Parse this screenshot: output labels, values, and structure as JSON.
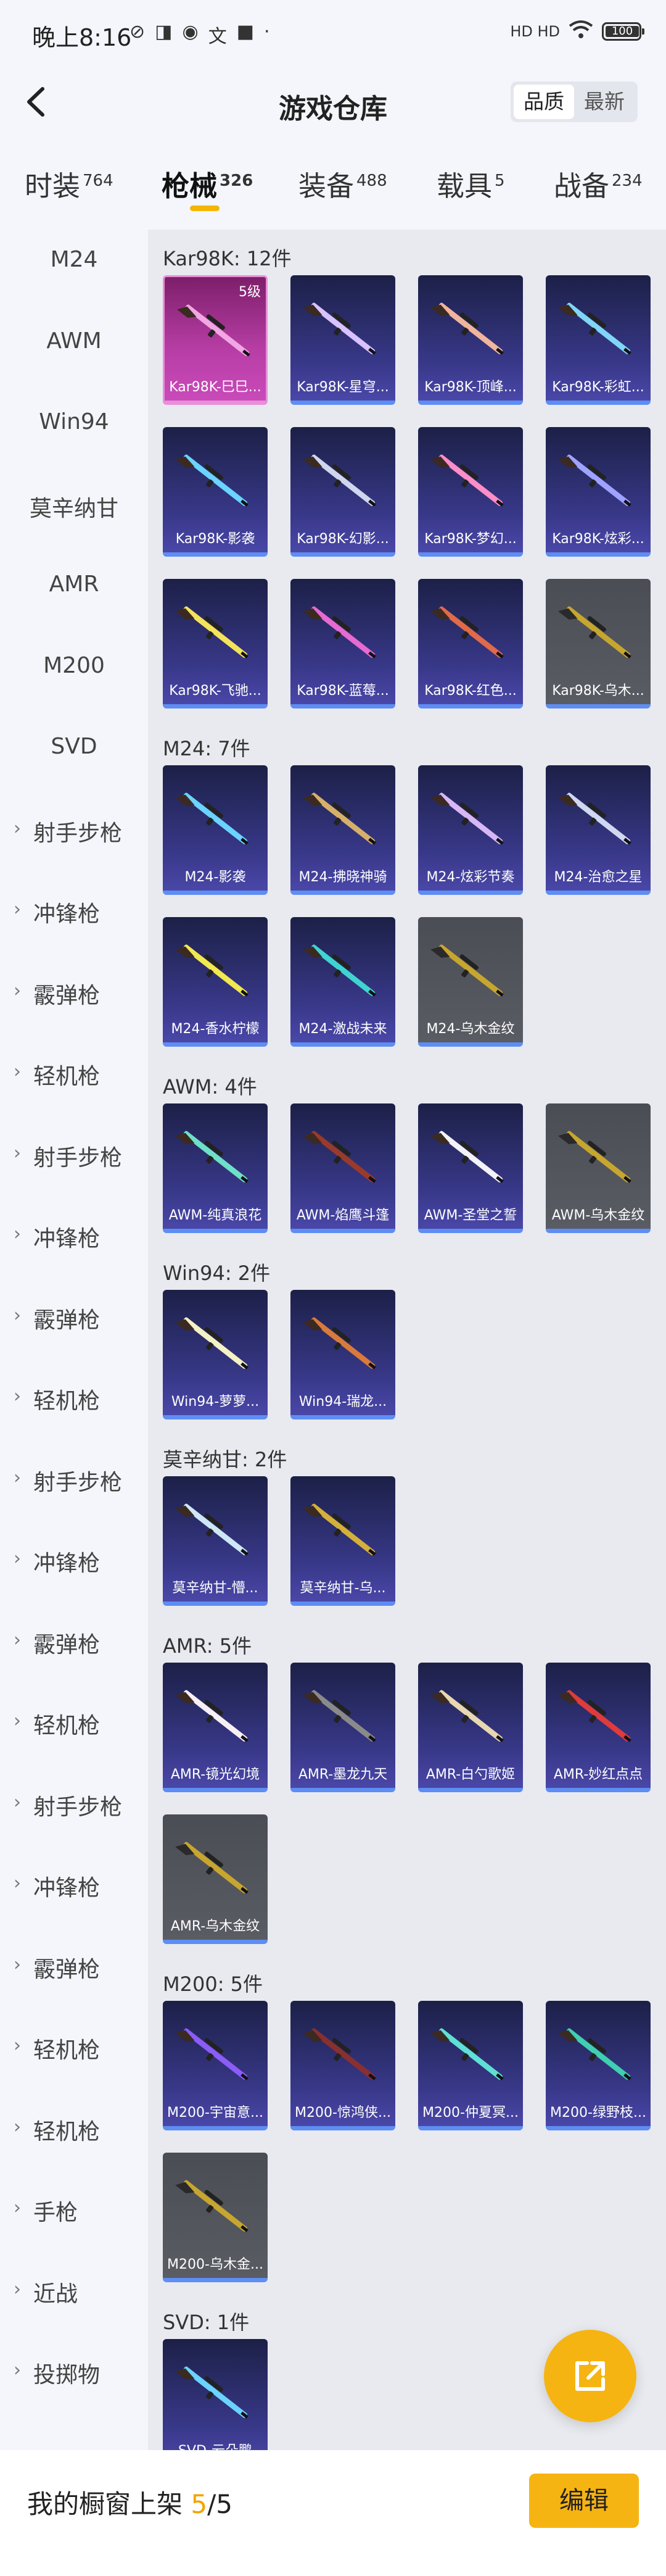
{
  "status": {
    "time": "晚上8:16",
    "network": "HD HD",
    "battery": "100"
  },
  "header": {
    "title": "游戏仓库",
    "sort_options": [
      "品质",
      "最新"
    ],
    "sort_active": 0
  },
  "tabs": [
    {
      "label": "时装",
      "count": "764"
    },
    {
      "label": "枪械",
      "count": "326"
    },
    {
      "label": "装备",
      "count": "488"
    },
    {
      "label": "载具",
      "count": "5"
    },
    {
      "label": "战备",
      "count": "234"
    }
  ],
  "active_tab": 1,
  "sidebar": {
    "items": [
      {
        "label": "M24",
        "chevron": false
      },
      {
        "label": "AWM",
        "chevron": false
      },
      {
        "label": "Win94",
        "chevron": false
      },
      {
        "label": "莫辛纳甘",
        "chevron": false
      },
      {
        "label": "AMR",
        "chevron": false
      },
      {
        "label": "M200",
        "chevron": false
      },
      {
        "label": "SVD",
        "chevron": false
      },
      {
        "label": "射手步枪",
        "chevron": true
      },
      {
        "label": "冲锋枪",
        "chevron": true
      },
      {
        "label": "霰弹枪",
        "chevron": true
      },
      {
        "label": "轻机枪",
        "chevron": true
      },
      {
        "label": "射手步枪",
        "chevron": true
      },
      {
        "label": "冲锋枪",
        "chevron": true
      },
      {
        "label": "霰弹枪",
        "chevron": true
      },
      {
        "label": "轻机枪",
        "chevron": true
      },
      {
        "label": "射手步枪",
        "chevron": true
      },
      {
        "label": "冲锋枪",
        "chevron": true
      },
      {
        "label": "霰弹枪",
        "chevron": true
      },
      {
        "label": "轻机枪",
        "chevron": true
      },
      {
        "label": "射手步枪",
        "chevron": true
      },
      {
        "label": "冲锋枪",
        "chevron": true
      },
      {
        "label": "霰弹枪",
        "chevron": true
      },
      {
        "label": "轻机枪",
        "chevron": true
      },
      {
        "label": "轻机枪",
        "chevron": true
      },
      {
        "label": "手枪",
        "chevron": true
      },
      {
        "label": "近战",
        "chevron": true
      },
      {
        "label": "投掷物",
        "chevron": true
      }
    ]
  },
  "sections": [
    {
      "title": "Kar98K: 12件",
      "items": [
        {
          "name": "Kar98K-巳巳...",
          "style": "pink",
          "level": "5级",
          "color": "#f2a6e4"
        },
        {
          "name": "Kar98K-星穹...",
          "style": "blue",
          "color": "#d8c2ff"
        },
        {
          "name": "Kar98K-顶峰...",
          "style": "blue",
          "color": "#f0b59c"
        },
        {
          "name": "Kar98K-彩虹...",
          "style": "blue",
          "color": "#7fd6f7"
        },
        {
          "name": "Kar98K-影袭",
          "style": "blue",
          "color": "#6ad3ff"
        },
        {
          "name": "Kar98K-幻影...",
          "style": "blue",
          "color": "#d0d6ee"
        },
        {
          "name": "Kar98K-梦幻...",
          "style": "blue",
          "color": "#ff8dc8"
        },
        {
          "name": "Kar98K-炫彩...",
          "style": "blue",
          "color": "#9fa3ff"
        },
        {
          "name": "Kar98K-飞驰...",
          "style": "blue",
          "color": "#f4e35a"
        },
        {
          "name": "Kar98K-蓝莓...",
          "style": "blue",
          "color": "#e66ad1"
        },
        {
          "name": "Kar98K-红色...",
          "style": "blue",
          "color": "#e06a4a"
        },
        {
          "name": "Kar98K-乌木...",
          "style": "gray",
          "color": "#c7a62f"
        }
      ]
    },
    {
      "title": "M24: 7件",
      "items": [
        {
          "name": "M24-影袭",
          "style": "blue",
          "color": "#6ad3ff"
        },
        {
          "name": "M24-拂晓神骑",
          "style": "blue",
          "color": "#d6b06a"
        },
        {
          "name": "M24-炫彩节奏",
          "style": "blue",
          "color": "#d7b7f5"
        },
        {
          "name": "M24-治愈之星",
          "style": "blue",
          "color": "#cfd8f0"
        },
        {
          "name": "M24-香水柠檬",
          "style": "blue",
          "color": "#f1e94f"
        },
        {
          "name": "M24-激战未来",
          "style": "blue",
          "color": "#3fd4d1"
        },
        {
          "name": "M24-乌木金纹",
          "style": "gray",
          "color": "#c7a62f"
        }
      ]
    },
    {
      "title": "AWM: 4件",
      "items": [
        {
          "name": "AWM-纯真浪花",
          "style": "blue",
          "color": "#6fe0c8"
        },
        {
          "name": "AWM-焰鹰斗篷",
          "style": "blue",
          "color": "#9a3a2a"
        },
        {
          "name": "AWM-圣堂之誓",
          "style": "blue",
          "color": "#f3f3f7"
        },
        {
          "name": "AWM-乌木金纹",
          "style": "gray",
          "color": "#c7a62f"
        }
      ]
    },
    {
      "title": "Win94: 2件",
      "items": [
        {
          "name": "Win94-萝萝...",
          "style": "blue",
          "color": "#f4f1c4"
        },
        {
          "name": "Win94-瑞龙...",
          "style": "blue",
          "color": "#d97a3b"
        }
      ]
    },
    {
      "title": "莫辛纳甘: 2件",
      "items": [
        {
          "name": "莫辛纳甘-懵...",
          "style": "blue",
          "color": "#cfe6f7"
        },
        {
          "name": "莫辛纳甘-乌...",
          "style": "blue",
          "color": "#d4b03a"
        }
      ]
    },
    {
      "title": "AMR: 5件",
      "items": [
        {
          "name": "AMR-镜光幻境",
          "style": "blue",
          "color": "#f6f0f4"
        },
        {
          "name": "AMR-墨龙九天",
          "style": "blue",
          "color": "#8a8a8a"
        },
        {
          "name": "AMR-白勺歌姬",
          "style": "blue",
          "color": "#e8d7b2"
        },
        {
          "name": "AMR-妙红点点",
          "style": "blue",
          "color": "#e03b3b"
        },
        {
          "name": "AMR-乌木金纹",
          "style": "gray",
          "color": "#c7a62f"
        }
      ]
    },
    {
      "title": "M200: 5件",
      "items": [
        {
          "name": "M200-宇宙意...",
          "style": "blue",
          "color": "#8b5cf6"
        },
        {
          "name": "M200-惊鸿侠...",
          "style": "blue",
          "color": "#8a2f2f"
        },
        {
          "name": "M200-仲夏冥...",
          "style": "blue",
          "color": "#5fe0d4"
        },
        {
          "name": "M200-绿野枝...",
          "style": "blue",
          "color": "#3fcfb0"
        },
        {
          "name": "M200-乌木金...",
          "style": "gray",
          "color": "#c7a62f"
        }
      ]
    },
    {
      "title": "SVD: 1件",
      "items": [
        {
          "name": "SVD-云朵鹏",
          "style": "blue",
          "color": "#6ad3ff"
        }
      ]
    }
  ],
  "bottom": {
    "label": "我的橱窗上架",
    "current": "5",
    "total": "/5",
    "edit_label": "编辑"
  }
}
